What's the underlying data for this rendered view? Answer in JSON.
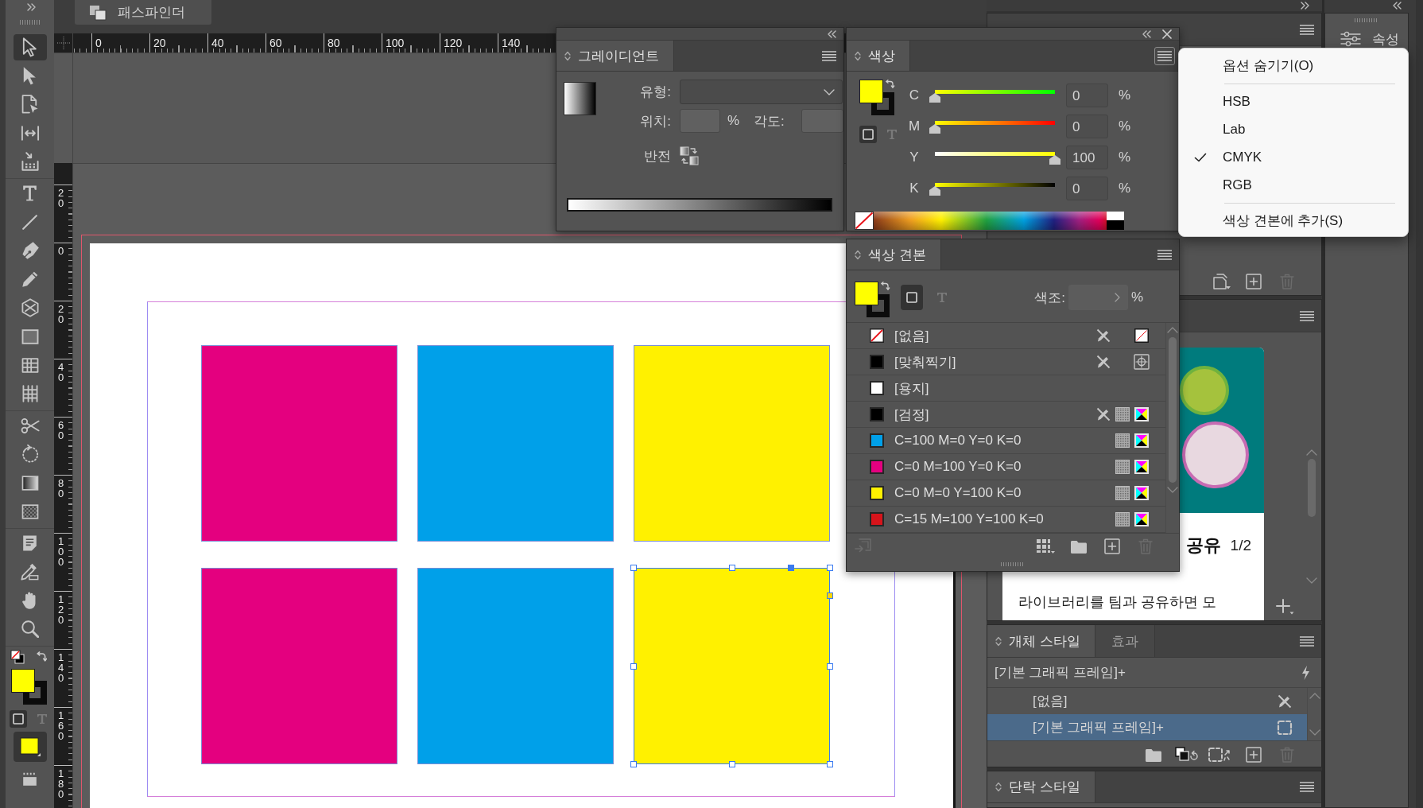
{
  "toolbar": {
    "tool_groups": [
      [
        {
          "kind": "selection",
          "selected": true
        },
        {
          "kind": "direct-selection",
          "selected": false
        },
        {
          "kind": "page",
          "selected": false
        },
        {
          "kind": "gap",
          "selected": false
        },
        {
          "kind": "content-collector",
          "selected": false
        }
      ],
      [
        {
          "kind": "type",
          "selected": false
        },
        {
          "kind": "line",
          "selected": false
        },
        {
          "kind": "pen",
          "selected": false
        },
        {
          "kind": "pencil",
          "selected": false
        },
        {
          "kind": "frame",
          "selected": false
        },
        {
          "kind": "rectangle",
          "selected": false
        },
        {
          "kind": "table",
          "selected": false
        },
        {
          "kind": "grid",
          "selected": false
        }
      ],
      [
        {
          "kind": "scissors",
          "selected": false
        },
        {
          "kind": "free-transform",
          "selected": false
        },
        {
          "kind": "gradient-swatch",
          "selected": false
        },
        {
          "kind": "gradient-feather",
          "selected": false
        }
      ],
      [
        {
          "kind": "note",
          "selected": false
        },
        {
          "kind": "eyedropper",
          "selected": false
        },
        {
          "kind": "hand",
          "selected": false
        },
        {
          "kind": "zoom",
          "selected": false
        }
      ]
    ],
    "formatting": [
      {
        "kind": "container",
        "selected": true
      },
      {
        "kind": "text",
        "selected": false
      }
    ],
    "apply_buttons": [
      {
        "kind": "color",
        "selected": true
      }
    ],
    "bottom_tools": [
      {
        "kind": "screen-mode",
        "selected": false
      }
    ]
  },
  "pathfinder_tab": {
    "label": "패스파인더"
  },
  "rulers": {
    "horizontal": [
      "0",
      "20",
      "40",
      "60",
      "80",
      "100",
      "120",
      "140"
    ],
    "vertical": [
      "20",
      "0",
      "20",
      "40",
      "60",
      "80",
      "100",
      "120",
      "140",
      "160",
      "180"
    ]
  },
  "canvas": {
    "frames": [
      {
        "color": "#e4007f",
        "selected": false
      },
      {
        "color": "#00a0e9",
        "selected": false
      },
      {
        "color": "#fff100",
        "selected": false
      },
      {
        "color": "#e4007f",
        "selected": false
      },
      {
        "color": "#00a0e9",
        "selected": false
      },
      {
        "color": "#fff100",
        "selected": true
      }
    ]
  },
  "gradient": {
    "tabs": [
      {
        "label": "그레이디언트",
        "selected": true
      }
    ],
    "type_label": "유형:",
    "location_label": "위치:",
    "location_unit": "%",
    "angle_label": "각도:",
    "reverse_label": "반전"
  },
  "color": {
    "tabs": [
      {
        "label": "색상",
        "selected": true
      }
    ],
    "menu_open": true,
    "formatting": [
      {
        "kind": "container",
        "selected": true
      },
      {
        "kind": "text",
        "selected": false
      }
    ],
    "channels": [
      {
        "name": "C",
        "level": 0,
        "value": "0",
        "unit": "%"
      },
      {
        "name": "M",
        "level": 0,
        "value": "0",
        "unit": "%"
      },
      {
        "name": "Y",
        "level": 1,
        "value": "100",
        "unit": "%"
      },
      {
        "name": "K",
        "level": 0,
        "value": "0",
        "unit": "%"
      }
    ]
  },
  "color_menu": {
    "groups": [
      [
        {
          "label": "옵션 숨기기(O)",
          "checked": false
        }
      ],
      [
        {
          "label": "HSB",
          "checked": false
        },
        {
          "label": "Lab",
          "checked": false
        },
        {
          "label": "CMYK",
          "checked": true
        },
        {
          "label": "RGB",
          "checked": false
        }
      ],
      [
        {
          "label": "색상 견본에 추가(S)",
          "checked": false
        }
      ]
    ]
  },
  "swatches": {
    "tabs": [
      {
        "label": "색상 견본",
        "selected": true
      }
    ],
    "formatting": [
      {
        "kind": "container",
        "selected": true
      },
      {
        "kind": "text",
        "selected": false
      }
    ],
    "tint_label": "색조:",
    "tint_unit": "%",
    "items": [
      {
        "name": "[없음]",
        "kind": "none",
        "locked": true,
        "selected": false
      },
      {
        "name": "[맞춰찍기]",
        "kind": "registration",
        "color": "#000000",
        "locked": true,
        "selected": false
      },
      {
        "name": "[용지]",
        "kind": "paper",
        "color": "#ffffff",
        "locked": false,
        "selected": false
      },
      {
        "name": "[검정]",
        "kind": "process",
        "color": "#000000",
        "locked": true,
        "selected": false
      },
      {
        "name": "C=100 M=0 Y=0 K=0",
        "kind": "process",
        "color": "#00a0e9",
        "locked": false,
        "selected": false
      },
      {
        "name": "C=0 M=100 Y=0 K=0",
        "kind": "process",
        "color": "#e4007f",
        "locked": false,
        "selected": false
      },
      {
        "name": "C=0 M=0 Y=100 K=0",
        "kind": "process",
        "color": "#fff100",
        "locked": false,
        "selected": false
      },
      {
        "name": "C=15 M=100 Y=100 K=0",
        "kind": "process",
        "color": "#d7141b",
        "locked": false,
        "selected": false
      }
    ],
    "footer_buttons": [
      {
        "kind": "import",
        "disabled": true
      },
      {
        "kind": "view",
        "disabled": false
      },
      {
        "kind": "folder",
        "disabled": false
      },
      {
        "kind": "new",
        "disabled": false
      },
      {
        "kind": "delete",
        "disabled": true
      }
    ]
  },
  "pages_panel": {
    "footer_buttons": [
      {
        "kind": "pages",
        "disabled": false
      },
      {
        "kind": "new",
        "disabled": false
      },
      {
        "kind": "delete",
        "disabled": true
      }
    ]
  },
  "libraries_panel": {
    "card": {
      "title": "공유",
      "page": "1/2",
      "text": "라이브러리를 팀과 공유하면 모"
    },
    "buttons": [
      {
        "kind": "add-menu",
        "disabled": false
      }
    ]
  },
  "object_styles": {
    "tabs": [
      {
        "label": "개체 스타일",
        "selected": true
      },
      {
        "label": "효과",
        "selected": false
      }
    ],
    "current": "[기본 그래픽 프레임]+",
    "styles": [
      {
        "name": "[없음]",
        "kind": "none",
        "selected": false
      },
      {
        "name": "[기본 그래픽 프레임]+",
        "kind": "frame",
        "selected": true
      }
    ],
    "footer_buttons": [
      {
        "kind": "folder",
        "disabled": false
      },
      {
        "kind": "clear-overrides",
        "disabled": false
      },
      {
        "kind": "clear-frame",
        "disabled": false
      },
      {
        "kind": "new",
        "disabled": false
      },
      {
        "kind": "delete",
        "disabled": true
      }
    ]
  },
  "paragraph_styles": {
    "tabs": [
      {
        "label": "단락 스타일",
        "selected": true
      }
    ]
  },
  "properties": {
    "label": "속성"
  }
}
